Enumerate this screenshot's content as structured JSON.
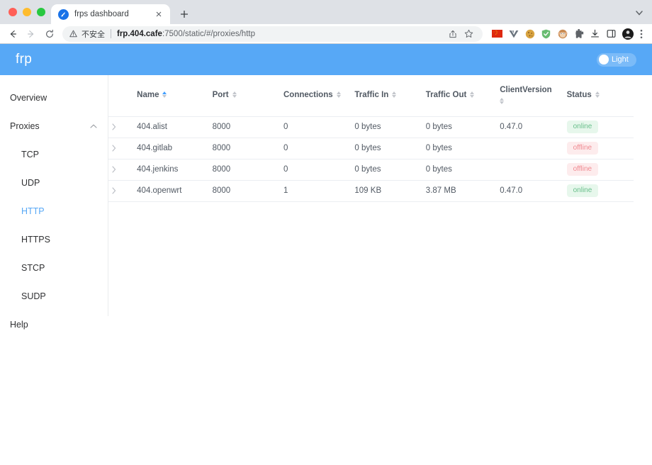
{
  "browser": {
    "tab": {
      "title": "frps dashboard",
      "favicon_icon": "frp-logo-icon",
      "close_icon": "close-icon"
    },
    "new_tab_label": "+",
    "tabstrip_chevron_icon": "chevron-down-icon",
    "nav": {
      "back_icon": "arrow-left-icon",
      "forward_icon": "arrow-right-icon",
      "reload_icon": "reload-icon"
    },
    "omnibox": {
      "warning_icon": "warning-triangle-icon",
      "security_label": "不安全",
      "url_bold": "frp.404.cafe",
      "url_rest": ":7500/static/#/proxies/http",
      "url_full": "frp.404.cafe:7500/static/#/proxies/http",
      "share_icon": "share-icon",
      "bookmark_icon": "star-icon"
    },
    "extensions": [
      {
        "name": "china-flag-extension-icon"
      },
      {
        "name": "vue-devtools-extension-icon"
      },
      {
        "name": "cookie-extension-icon"
      },
      {
        "name": "adguard-shield-extension-icon"
      },
      {
        "name": "monkey-extension-icon"
      },
      {
        "name": "puzzle-extensions-icon"
      },
      {
        "name": "downloads-icon"
      },
      {
        "name": "side-panel-icon"
      },
      {
        "name": "profile-avatar-icon"
      }
    ],
    "menu_icon": "three-dots-menu-icon"
  },
  "app": {
    "brand": "frp",
    "theme_toggle": {
      "label": "Light",
      "state": "light"
    },
    "header_color": "#57a8f6",
    "accent_color": "#409eff"
  },
  "sidebar": {
    "items": [
      {
        "label": "Overview",
        "level": "top",
        "active": false
      },
      {
        "label": "Proxies",
        "level": "top",
        "active": false,
        "chevron_icon": "chevron-up-icon",
        "expanded": true
      },
      {
        "label": "TCP",
        "level": "sub",
        "active": false
      },
      {
        "label": "UDP",
        "level": "sub",
        "active": false
      },
      {
        "label": "HTTP",
        "level": "sub",
        "active": true
      },
      {
        "label": "HTTPS",
        "level": "sub",
        "active": false
      },
      {
        "label": "STCP",
        "level": "sub",
        "active": false
      },
      {
        "label": "SUDP",
        "level": "sub",
        "active": false
      },
      {
        "label": "Help",
        "level": "top",
        "active": false
      }
    ]
  },
  "table": {
    "columns": [
      {
        "key": "expand",
        "label": "",
        "sortable": false
      },
      {
        "key": "name",
        "label": "Name",
        "sortable": true,
        "sort_active": "asc"
      },
      {
        "key": "port",
        "label": "Port",
        "sortable": true
      },
      {
        "key": "connections",
        "label": "Connections",
        "sortable": true
      },
      {
        "key": "traffic_in",
        "label": "Traffic In",
        "sortable": true
      },
      {
        "key": "traffic_out",
        "label": "Traffic Out",
        "sortable": true
      },
      {
        "key": "client_version",
        "label": "ClientVersion",
        "sortable": true
      },
      {
        "key": "status",
        "label": "Status",
        "sortable": true
      }
    ],
    "rows": [
      {
        "expand_icon": "chevron-right-icon",
        "name": "404.alist",
        "port": "8000",
        "connections": "0",
        "traffic_in": "0 bytes",
        "traffic_out": "0 bytes",
        "client_version": "0.47.0",
        "status": "online"
      },
      {
        "expand_icon": "chevron-right-icon",
        "name": "404.gitlab",
        "port": "8000",
        "connections": "0",
        "traffic_in": "0 bytes",
        "traffic_out": "0 bytes",
        "client_version": "",
        "status": "offline"
      },
      {
        "expand_icon": "chevron-right-icon",
        "name": "404.jenkins",
        "port": "8000",
        "connections": "0",
        "traffic_in": "0 bytes",
        "traffic_out": "0 bytes",
        "client_version": "",
        "status": "offline"
      },
      {
        "expand_icon": "chevron-right-icon",
        "name": "404.openwrt",
        "port": "8000",
        "connections": "1",
        "traffic_in": "109 KB",
        "traffic_out": "3.87 MB",
        "client_version": "0.47.0",
        "status": "online"
      }
    ],
    "status_colors": {
      "online_bg": "#e7f7ec",
      "online_fg": "#68bf8b",
      "offline_bg": "#fdeced",
      "offline_fg": "#f08a91"
    }
  }
}
